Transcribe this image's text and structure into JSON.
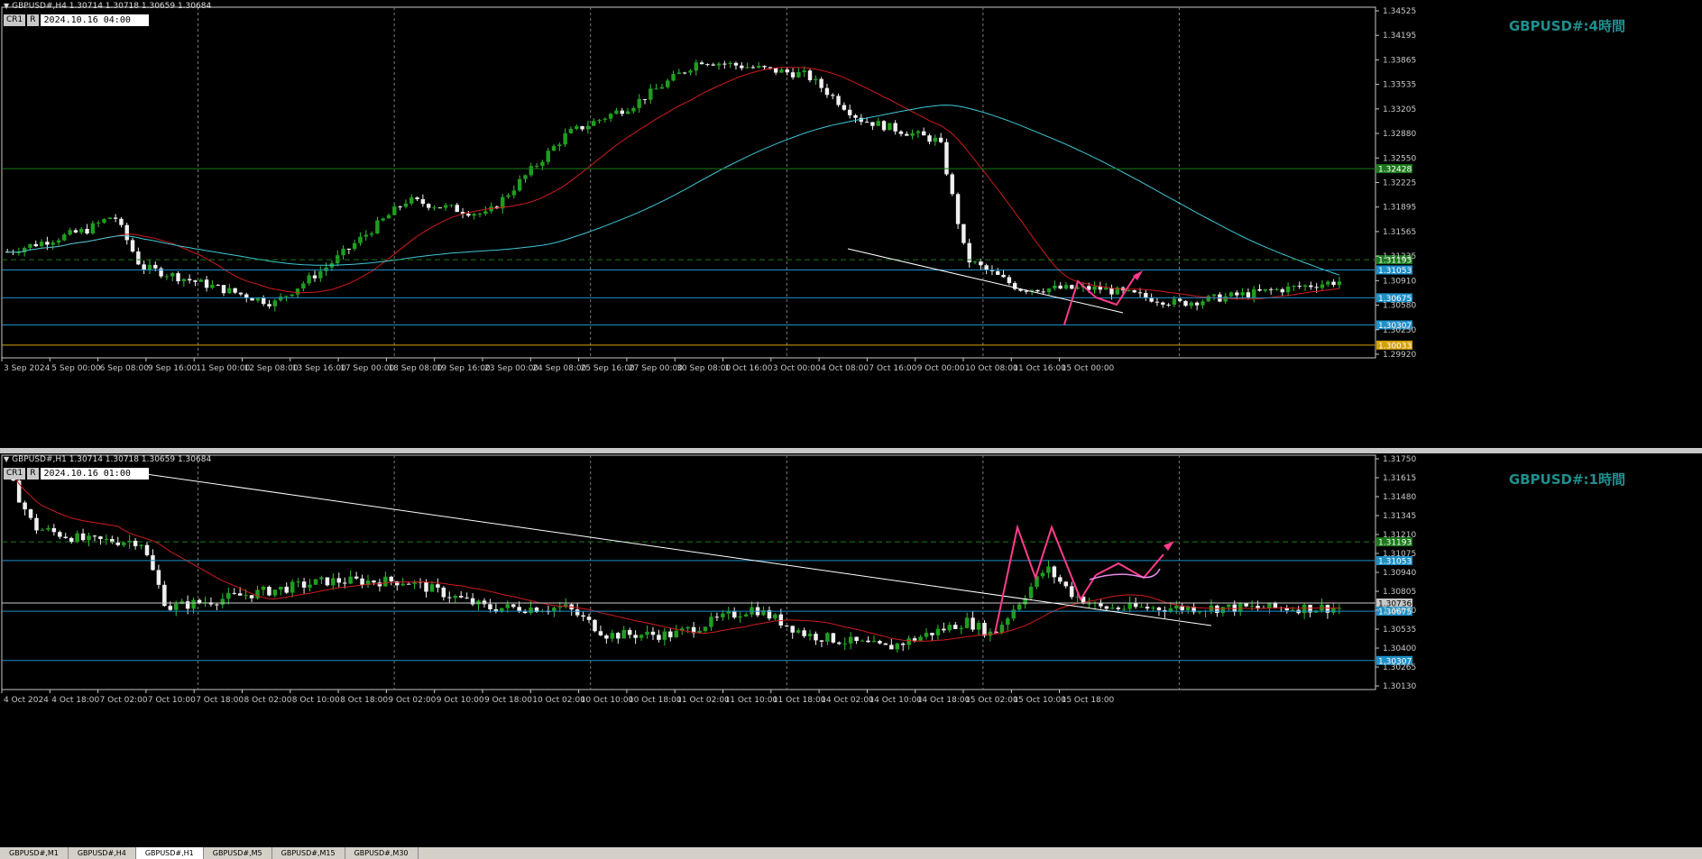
{
  "top": {
    "symbol_line": "GBPUSD#,H4  1.30714 1.30718 1.30659 1.30684",
    "ctrl_label": "CR1",
    "ctrl_r": "R",
    "date_value": "2024.10.16 04:00",
    "watermark": "GBPUSD#:4時間",
    "y_ticks": [
      "1.34525",
      "1.34195",
      "1.33865",
      "1.33535",
      "1.33205",
      "1.32880",
      "1.32550",
      "1.32225",
      "1.31895",
      "1.31565",
      "1.31235",
      "1.30910",
      "1.30580",
      "1.30250",
      "1.29920"
    ],
    "x_ticks": [
      "3 Sep 2024",
      "5 Sep 00:00",
      "6 Sep 08:00",
      "9 Sep 16:00",
      "11 Sep 00:00",
      "12 Sep 08:00",
      "13 Sep 16:00",
      "17 Sep 00:00",
      "18 Sep 08:00",
      "19 Sep 16:00",
      "23 Sep 00:00",
      "24 Sep 08:00",
      "25 Sep 16:00",
      "27 Sep 00:00",
      "30 Sep 08:00",
      "1 Oct 16:00",
      "3 Oct 00:00",
      "4 Oct 08:00",
      "7 Oct 16:00",
      "9 Oct 00:00",
      "10 Oct 08:00",
      "11 Oct 16:00",
      "15 Oct 00:00"
    ],
    "price_tags": [
      {
        "label": "1.32428",
        "level": 1.32428,
        "color": "#1a7a1a"
      },
      {
        "label": "1.31193",
        "level": 1.31193,
        "color": "#1a7a1a"
      },
      {
        "label": "1.31053",
        "level": 1.31053,
        "color": "#1e90c8"
      },
      {
        "label": "1.30675",
        "level": 1.30675,
        "color": "#1e90c8"
      },
      {
        "label": "1.30307",
        "level": 1.30307,
        "color": "#1e90c8"
      },
      {
        "label": "1.30033",
        "level": 1.30033,
        "color": "#d4a000"
      }
    ]
  },
  "bottom": {
    "symbol_line": "GBPUSD#,H1  1.30714 1.30718 1.30659 1.30684",
    "ctrl_label": "CR1",
    "ctrl_r": "R",
    "date_value": "2024.10.16 01:00",
    "watermark": "GBPUSD#:1時間",
    "y_ticks": [
      "1.31750",
      "1.31615",
      "1.31480",
      "1.31345",
      "1.31210",
      "1.31075",
      "1.30940",
      "1.30805",
      "1.30670",
      "1.30535",
      "1.30400",
      "1.30265",
      "1.30130"
    ],
    "x_ticks": [
      "4 Oct 2024",
      "4 Oct 18:00",
      "7 Oct 02:00",
      "7 Oct 10:00",
      "7 Oct 18:00",
      "8 Oct 02:00",
      "8 Oct 10:00",
      "8 Oct 18:00",
      "9 Oct 02:00",
      "9 Oct 10:00",
      "9 Oct 18:00",
      "10 Oct 02:00",
      "10 Oct 10:00",
      "10 Oct 18:00",
      "11 Oct 02:00",
      "11 Oct 10:00",
      "11 Oct 18:00",
      "14 Oct 02:00",
      "14 Oct 10:00",
      "14 Oct 18:00",
      "15 Oct 02:00",
      "15 Oct 10:00",
      "15 Oct 18:00"
    ],
    "price_tags": [
      {
        "label": "1.31193",
        "level": 1.31193,
        "color": "#1a7a1a"
      },
      {
        "label": "1.31053",
        "level": 1.31053,
        "color": "#1e90c8"
      },
      {
        "label": "1.30736",
        "level": 1.30736,
        "color": "#c8c8c8"
      },
      {
        "label": "1.30675",
        "level": 1.30675,
        "color": "#1e90c8"
      },
      {
        "label": "1.30307",
        "level": 1.30307,
        "color": "#1e90c8"
      }
    ]
  },
  "tabs": [
    "GBPUSD#,M1",
    "GBPUSD#,H4",
    "GBPUSD#,H1",
    "GBPUSD#,M5",
    "GBPUSD#,M15",
    "GBPUSD#,M30"
  ],
  "active_tab": 2
}
